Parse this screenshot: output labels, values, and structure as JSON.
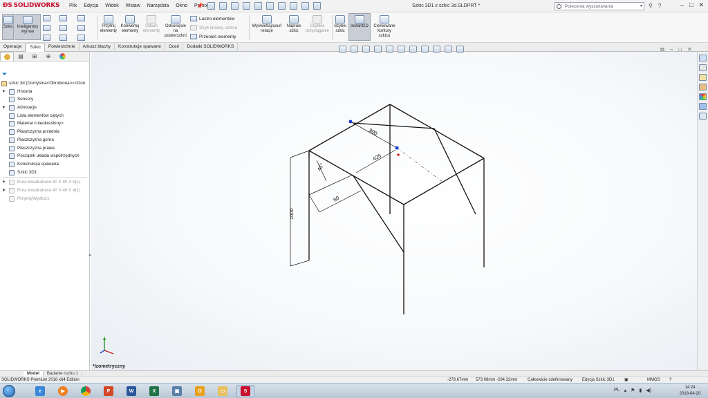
{
  "app": {
    "logo": "SOLIDWORKS",
    "document_title": "Szkic 3D1 z szkic 3d.SLDPRT *"
  },
  "menu": [
    "Plik",
    "Edycja",
    "Widok",
    "Wstaw",
    "Narzędzia",
    "Okno",
    "Pomoc"
  ],
  "search": {
    "placeholder": "Polecenia wyszukiwania"
  },
  "ribbon": {
    "sketch": "Szkic",
    "smart_dim": "Inteligentny wymiar",
    "trim": "Przytnij elementy",
    "convert": "Konwertuj elementy",
    "offset_entities": "Odsuń elementy",
    "offset_surface": "Odsunięcie na powierzchni",
    "mirror": "Lustro elementów",
    "linear_pattern": "Szyk liniowy szkicu",
    "move": "Przenieś elementy",
    "relations": "Wyświetlaj/usuń relacje",
    "repair": "Napraw szkic",
    "quick_snaps_dim": "Szybkie przyciąganie",
    "quick_sketch": "Szybki szkic",
    "instant2d": "Instant2D",
    "shaded": "Cieniowane kontury szkicu"
  },
  "tabs": [
    "Operacje",
    "Szkic",
    "Powierzchnie",
    "Arkusz blachy",
    "Konstrukcje spawane",
    "Oceń",
    "Dodatki SOLIDWORKS"
  ],
  "tree": {
    "root": "szkic 3d  (Domyślna<Obrobiona><<Don",
    "items": [
      "Historia",
      "Sensory",
      "Adnotacje",
      "Lista elementów ciętych",
      "Materiał <nieokreślony>",
      "Płaszczyzna przednia",
      "Płaszczyzna górna",
      "Płaszczyzna prawa",
      "Początek układu współrzędnych",
      "Konstrukcja spawana",
      "Szkic 3D1"
    ],
    "dim_items": [
      "Rura kwadratowa 80 X 80 X 5(1)",
      "Rura kwadratowa 40 X 40 X 4(1)",
      "Przytnij/Wydłuż1"
    ]
  },
  "viewport": {
    "view_label": "*Izometryczny",
    "dimensions": [
      "900",
      "425",
      "45°",
      "80",
      "1000"
    ]
  },
  "bottom_tabs": [
    "Model",
    "Badanie ruchu 1"
  ],
  "status": {
    "edition": "SOLIDWORKS Premium 2018 x64 Edition",
    "x": "-278.67mm",
    "coords": "573.08mm -294.32mm",
    "defined": "Całkowicie zdefiniowany",
    "editing": "Edycja Szkic 3D1",
    "units": "MMGS"
  },
  "taskbar": {
    "time": "14:24",
    "date": "2018-04-20",
    "lang": "PL"
  }
}
